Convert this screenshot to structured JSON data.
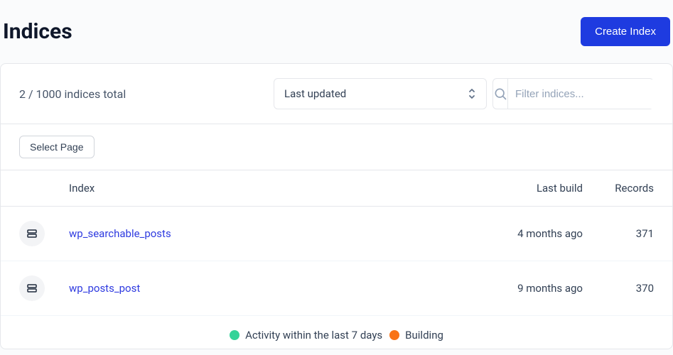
{
  "header": {
    "title": "Indices",
    "create_button": "Create Index"
  },
  "summary": {
    "count_text": "2 / 1000 indices total"
  },
  "sort": {
    "selected": "Last updated"
  },
  "filter": {
    "placeholder": "Filter indices..."
  },
  "select_page_button": "Select Page",
  "columns": {
    "index": "Index",
    "last_build": "Last build",
    "records": "Records"
  },
  "rows": [
    {
      "name": "wp_searchable_posts",
      "last_build": "4 months ago",
      "records": "371"
    },
    {
      "name": "wp_posts_post",
      "last_build": "9 months ago",
      "records": "370"
    }
  ],
  "legend": {
    "activity": "Activity within the last 7 days",
    "building": "Building"
  }
}
